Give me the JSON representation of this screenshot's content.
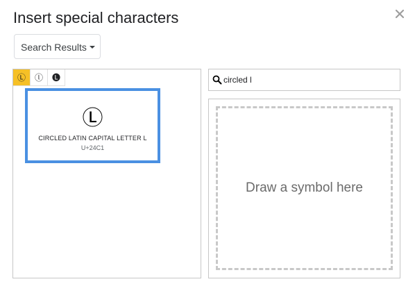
{
  "dialog": {
    "title": "Insert special characters",
    "close_icon": "close-icon"
  },
  "category_dropdown": {
    "selected": "Search Results",
    "icon": "caret-down-icon"
  },
  "recent_characters": [
    {
      "glyph": "Ⓛ",
      "name": "circled-latin-capital-letter-l",
      "selected": true
    },
    {
      "glyph": "ⓛ",
      "name": "circled-latin-small-letter-l",
      "selected": false
    },
    {
      "glyph": "🅛",
      "name": "negative-circled-latin-capital-letter-l",
      "selected": false
    }
  ],
  "result_card": {
    "glyph": "Ⓛ",
    "name": "CIRCLED LATIN CAPITAL LETTER L",
    "code": "U+24C1"
  },
  "search": {
    "value": "circled l",
    "icon": "search-icon"
  },
  "draw_area": {
    "hint": "Draw a symbol here"
  },
  "colors": {
    "selected_cell": "#f6c026",
    "card_border": "#4a90e2",
    "dashed_border": "#c8c8c8"
  }
}
